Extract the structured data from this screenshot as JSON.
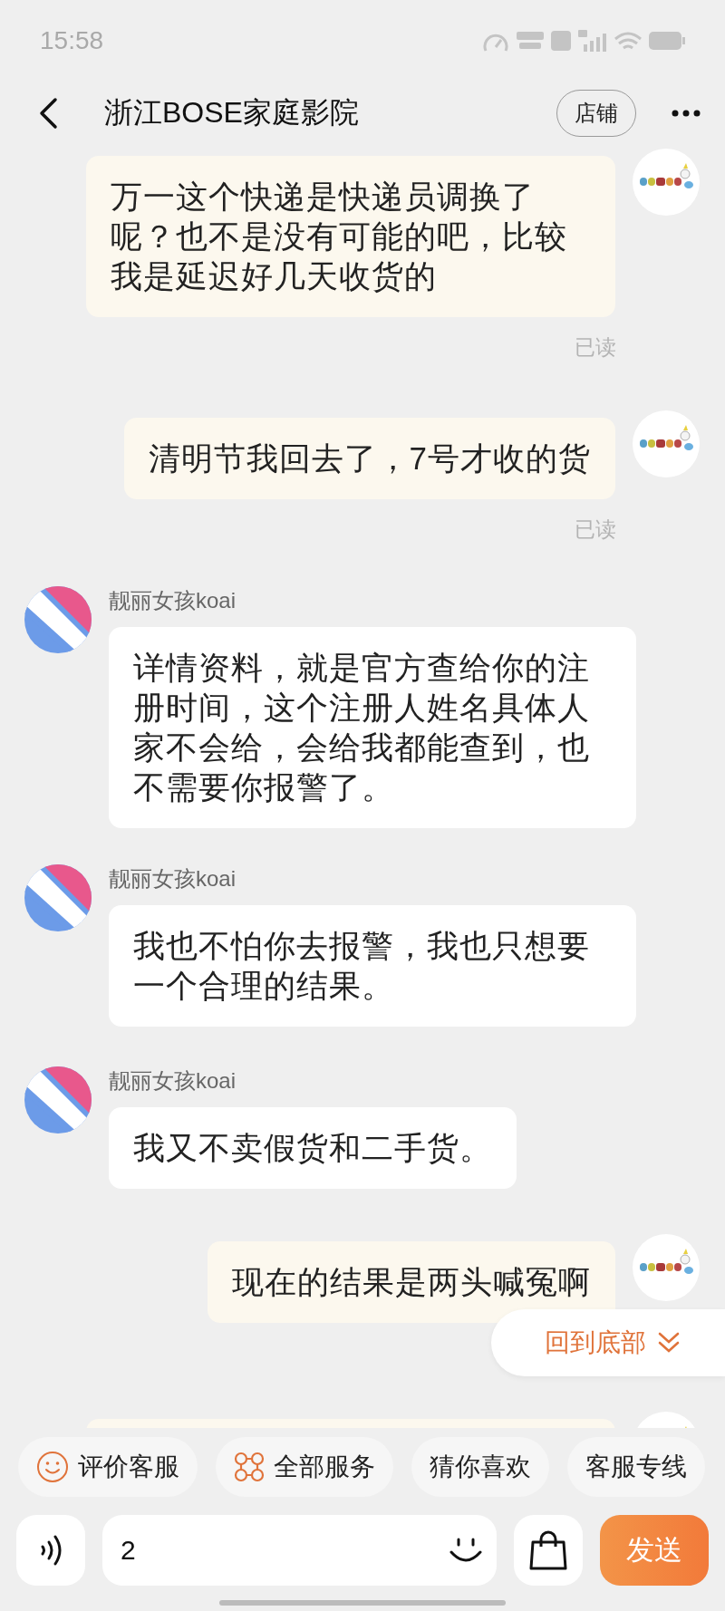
{
  "status_bar": {
    "time": "15:58"
  },
  "header": {
    "title": "浙江BOSE家庭影院",
    "shop_button": "店铺"
  },
  "messages": [
    {
      "kind": "outgoing",
      "text": "万一这个快递是快递员调换了呢？也不是没有可能的吧，比较我是延迟好几天收货的",
      "receipt": "已读"
    },
    {
      "kind": "outgoing",
      "text": "清明节我回去了，7号才收的货",
      "receipt": "已读"
    },
    {
      "kind": "incoming",
      "sender": "靓丽女孩koai",
      "text": "详情资料，就是官方查给你的注册时间，这个注册人姓名具体人家不会给，会给我都能查到，也不需要你报警了。"
    },
    {
      "kind": "incoming",
      "sender": "靓丽女孩koai",
      "text": "我也不怕你去报警，我也只想要一个合理的结果。"
    },
    {
      "kind": "incoming",
      "sender": "靓丽女孩koai",
      "text": "我又不卖假货和二手货。"
    },
    {
      "kind": "outgoing",
      "text": "现在的结果是两头喊冤啊"
    },
    {
      "kind": "cut"
    }
  ],
  "jump_to_bottom": "回到底部",
  "quick_actions": [
    {
      "label": "评价客服",
      "kind": "rating"
    },
    {
      "label": "全部服务",
      "kind": "services"
    },
    {
      "label": "猜你喜欢",
      "kind": "plain"
    },
    {
      "label": "客服专线",
      "kind": "plain"
    }
  ],
  "composer": {
    "value": "2",
    "send_button": "发送"
  }
}
